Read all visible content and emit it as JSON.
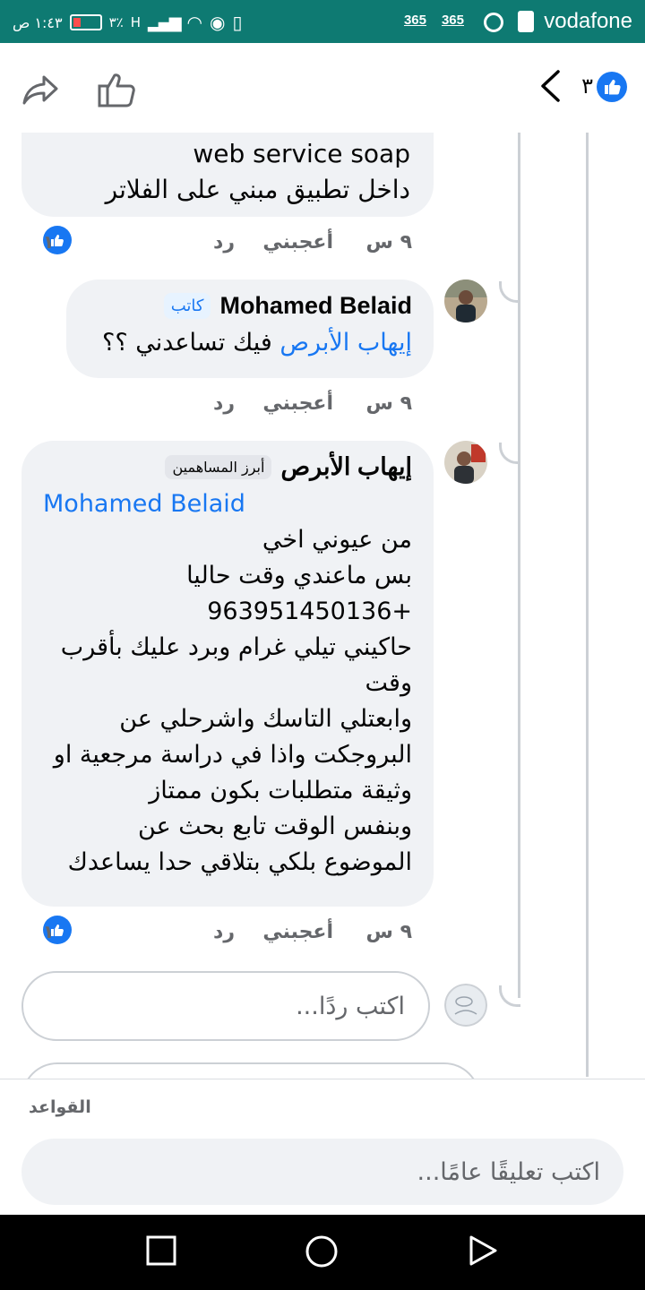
{
  "status_bar": {
    "carrier": "vodafone",
    "app1": "365",
    "app2": "365",
    "time": "١:٤٣ ص",
    "battery_pct": "٣٪",
    "signal": "H"
  },
  "header": {
    "like_count": "٣"
  },
  "comments": [
    {
      "lines": [
        "web service soap",
        "داخل تطبيق مبني على الفلاتر"
      ],
      "time": "٩ س",
      "like_label": "أعجبني",
      "reply_label": "رد",
      "reactions": "١"
    },
    {
      "author": "Mohamed Belaid",
      "badge": "كاتب",
      "mention": "إيهاب الأبرص",
      "text": " فيك تساعدني ؟؟",
      "time": "٩ س",
      "like_label": "أعجبني",
      "reply_label": "رد"
    },
    {
      "author": "إيهاب الأبرص",
      "badge": "أبرز المساهمين",
      "mention": "Mohamed Belaid",
      "lines": [
        "من عيوني اخي",
        "بس ماعندي وقت حاليا",
        "963951450136+",
        "حاكيني تيلي غرام وبرد عليك بأقرب",
        "وقت",
        "وابعتلي التاسك واشرحلي عن",
        "البروجكت واذا في دراسة مرجعية او",
        "وثيقة متطلبات بكون ممتاز",
        "وبنفس الوقت تابع بحث عن",
        "الموضوع بلكي بتلاقي حدا يساعدك"
      ],
      "time": "٩ س",
      "like_label": "أعجبني",
      "reply_label": "رد",
      "reactions": "١"
    }
  ],
  "reply_input": {
    "placeholder": "اكتب ردًا..."
  },
  "footer": {
    "rules": "القواعد",
    "public_placeholder": "اكتب تعليقًا عامًا..."
  }
}
